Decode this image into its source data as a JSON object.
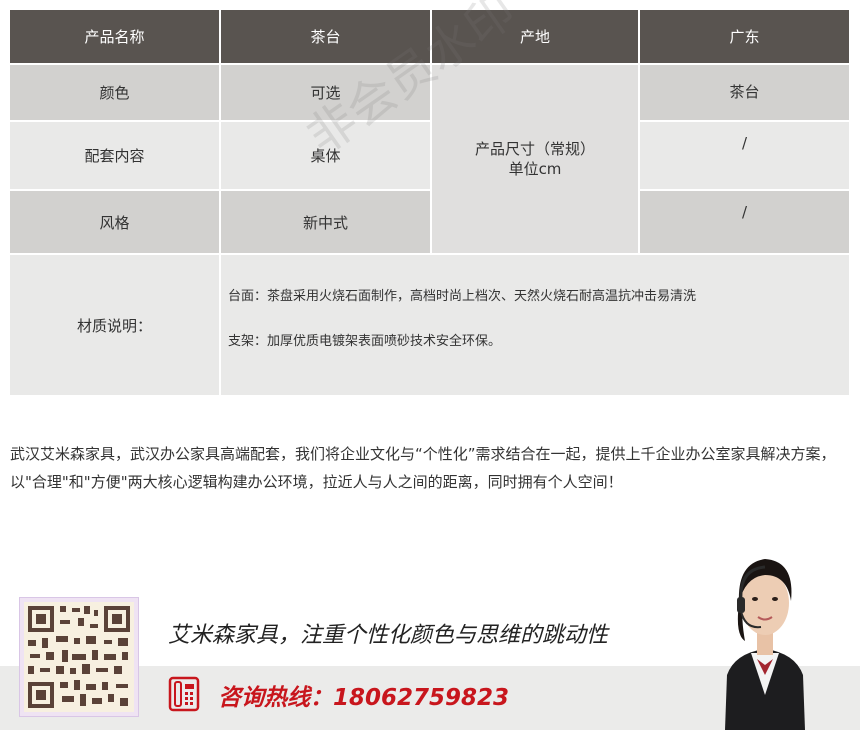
{
  "table": {
    "header": [
      "产品名称",
      "茶台",
      "产地",
      "广东"
    ],
    "rows": [
      {
        "label": "颜色",
        "value": "可选"
      },
      {
        "label": "配套内容",
        "value": "桌体"
      },
      {
        "label": "风格",
        "value": "新中式"
      }
    ],
    "size_label_line1": "产品尺寸（常规）",
    "size_label_line2": "单位cm",
    "size_values": [
      "茶台",
      "/",
      "/"
    ],
    "material_label": "材质说明：",
    "material_lines": [
      "台面：茶盘采用火烧石面制作，高档时尚上档次、天然火烧石耐高温抗冲击易清洗",
      "支架：加厚优质电镀架表面喷砂技术安全环保。"
    ]
  },
  "watermark": "非会员水印",
  "description": "武汉艾米森家具，武汉办公家具高端配套，我们将企业文化与“个性化”需求结合在一起，提供上千企业办公室家具解决方案，以\"合理\"和\"方便\"两大核心逻辑构建办公环境，拉近人与人之间的距离，同时拥有个人空间！",
  "footer": {
    "slogan": "艾米森家具，注重个性化颜色与思维的跳动性",
    "hotline_label": "咨询热线：",
    "hotline_number": "18062759823"
  },
  "colors": {
    "header_bg": "#595450",
    "hotline": "#c8161d"
  },
  "icons": [
    "qr-code-icon",
    "phone-icon",
    "customer-service-agent-icon"
  ]
}
